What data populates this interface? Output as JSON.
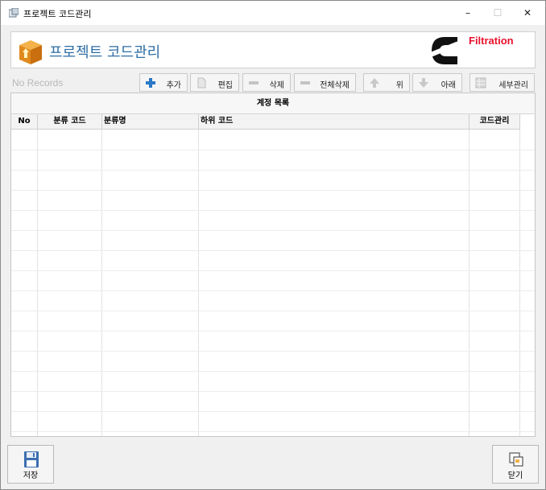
{
  "window": {
    "title": "프로젝트 코드관리",
    "controls": {
      "minimize": "–",
      "maximize": "☐",
      "close": "✕"
    }
  },
  "header": {
    "title": "프로젝트 코드관리",
    "logo_icon": "cummins-logo",
    "brand_text": "Filtration",
    "brand_color": "#e8112d",
    "title_color": "#2f6ea5"
  },
  "toolbar": {
    "status_text": "No Records",
    "buttons": [
      {
        "id": "add",
        "label": "추가",
        "icon": "plus-icon"
      },
      {
        "id": "edit",
        "label": "편집",
        "icon": "page-icon"
      },
      {
        "id": "delete",
        "label": "삭제",
        "icon": "minus-icon"
      },
      {
        "id": "delete_all",
        "label": "전체삭제",
        "icon": "minus-icon"
      },
      {
        "id": "up",
        "label": "위",
        "icon": "arrow-up-icon"
      },
      {
        "id": "down",
        "label": "아래",
        "icon": "arrow-down-icon"
      },
      {
        "id": "detail",
        "label": "세부관리",
        "icon": "grid-icon"
      }
    ]
  },
  "grid": {
    "band_title": "계정 목록",
    "columns": [
      "No",
      "분류 코드",
      "분류명",
      "하위 코드",
      "코드관리"
    ],
    "rows": []
  },
  "footer": {
    "save_label": "저장",
    "close_label": "닫기"
  }
}
